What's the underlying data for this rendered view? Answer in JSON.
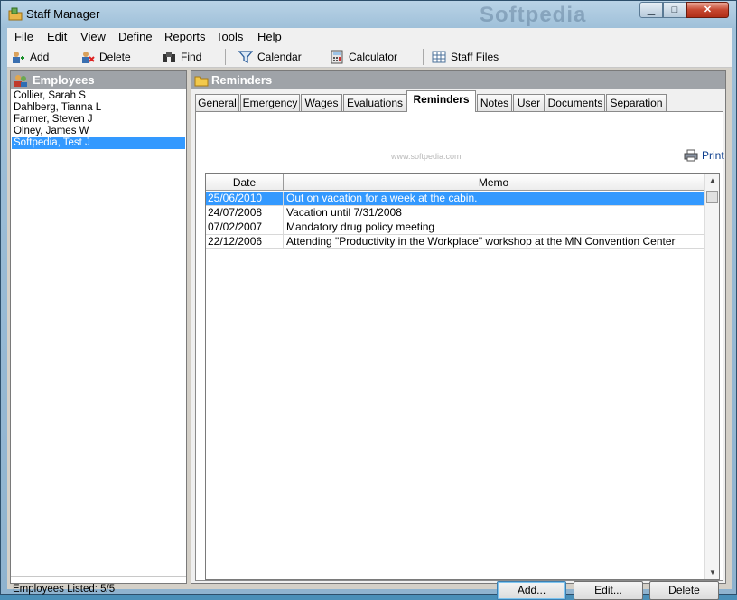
{
  "window": {
    "title": "Staff Manager",
    "watermark": "Softpedia"
  },
  "caption_buttons": {
    "minimize": "▁",
    "maximize": "□",
    "close": "✕"
  },
  "menu": [
    {
      "label": "File",
      "u": "F",
      "rest": "ile"
    },
    {
      "label": "Edit",
      "u": "E",
      "rest": "dit"
    },
    {
      "label": "View",
      "u": "V",
      "rest": "iew"
    },
    {
      "label": "Define",
      "u": "D",
      "rest": "efine"
    },
    {
      "label": "Reports",
      "u": "R",
      "rest": "eports"
    },
    {
      "label": "Tools",
      "u": "T",
      "rest": "ools"
    },
    {
      "label": "Help",
      "u": "H",
      "rest": "elp"
    }
  ],
  "toolbar": {
    "add": "Add",
    "delete": "Delete",
    "find": "Find",
    "calendar": "Calendar",
    "calculator": "Calculator",
    "staff_files": "Staff Files"
  },
  "employees": {
    "header": "Employees",
    "items": [
      "Collier, Sarah S",
      "Dahlberg, Tianna L",
      "Farmer, Steven J",
      "Olney, James W",
      "Softpedia, Test J"
    ],
    "selected_index": 4,
    "footer": "Employees Listed: 5/5"
  },
  "reminders": {
    "header": "Reminders",
    "tabs": [
      "General",
      "Emergency",
      "Wages",
      "Evaluations",
      "Reminders",
      "Notes",
      "User",
      "Documents",
      "Separation"
    ],
    "active_tab": 4,
    "print_label": "Print",
    "watermark": "www.softpedia.com",
    "columns": {
      "date": "Date",
      "memo": "Memo"
    },
    "rows": [
      {
        "date": "25/06/2010",
        "memo": "Out on vacation for a week at the cabin."
      },
      {
        "date": "24/07/2008",
        "memo": "Vacation until 7/31/2008"
      },
      {
        "date": "07/02/2007",
        "memo": "Mandatory drug policy meeting"
      },
      {
        "date": "22/12/2006",
        "memo": "Attending \"Productivity in the Workplace\" workshop at the MN Convention Center"
      }
    ],
    "selected_row": 0,
    "buttons": {
      "add": "Add...",
      "edit": "Edit...",
      "delete": "Delete"
    }
  }
}
